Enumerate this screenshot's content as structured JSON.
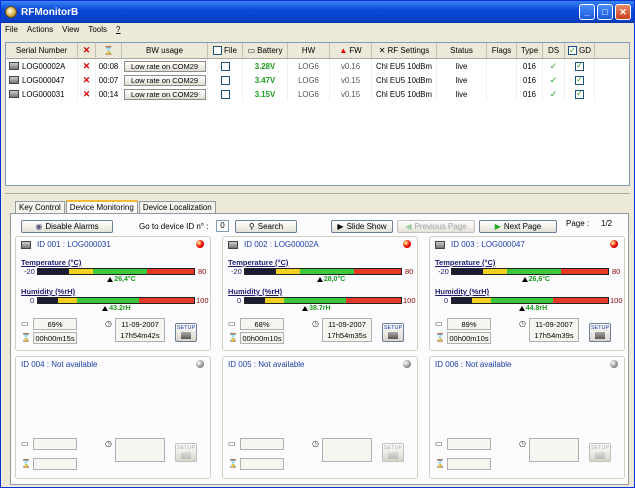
{
  "window": {
    "title": "RFMonitorB"
  },
  "menu": [
    "File",
    "Actions",
    "View",
    "Tools",
    "?"
  ],
  "grid": {
    "headers": {
      "serial": "Serial Number",
      "bw": "BW usage",
      "file": "File",
      "battery": "Battery",
      "hw": "HW",
      "fw": "FW",
      "rf": "RF Settings",
      "status": "Status",
      "flags": "Flags",
      "type": "Type",
      "ds": "DS",
      "gd": "GD"
    },
    "rows": [
      {
        "serial": "LOG00002A",
        "time": "00:08",
        "bw": "Low rate on COM29",
        "battery": "3.28V",
        "hw": "LOG6",
        "fw": "v0.16",
        "rf": "Chl EU5 10dBm",
        "status": "live",
        "type": "016"
      },
      {
        "serial": "LOG000047",
        "time": "00:07",
        "bw": "Low rate on COM29",
        "battery": "3.47V",
        "hw": "LOG6",
        "fw": "v0.15",
        "rf": "Chl EU5 10dBm",
        "status": "live",
        "type": "016"
      },
      {
        "serial": "LOG000031",
        "time": "00:14",
        "bw": "Low rate on COM29",
        "battery": "3.15V",
        "hw": "LOG6",
        "fw": "v0.15",
        "rf": "Chl EU5 10dBm",
        "status": "live",
        "type": "016"
      }
    ]
  },
  "tabs": [
    "Key Control",
    "Device Monitoring",
    "Device Localization"
  ],
  "toolbar": {
    "disable_alarms": "Disable Alarms",
    "goto_label": "Go to device ID n° :",
    "goto_value": "0",
    "search": "Search",
    "slideshow": "Slide Show",
    "prev": "Previous Page",
    "next": "Next Page",
    "page_label": "Page :",
    "page_value": "1/2"
  },
  "cards": [
    {
      "title": "ID 001 : LOG000031",
      "temp_label": "Temperature (°C)",
      "temp_min": "-20",
      "temp_max": "80",
      "temp_val": "26,4°C",
      "temp_frac": 0.464,
      "hum_label": "Humidity (%rH)",
      "hum_min": "0",
      "hum_max": "100",
      "hum_val": "43.2rH",
      "hum_frac": 0.432,
      "battery": "69%",
      "date": "11-09-2007",
      "time": "17h54m42s",
      "uptime": "00h00m15s",
      "setup": "SETUP"
    },
    {
      "title": "ID 002 : LOG00002A",
      "temp_label": "Temperature (°C)",
      "temp_min": "-20",
      "temp_max": "80",
      "temp_val": "28,0°C",
      "temp_frac": 0.48,
      "hum_label": "Humidity (%rH)",
      "hum_min": "0",
      "hum_max": "100",
      "hum_val": "38.7rH",
      "hum_frac": 0.387,
      "battery": "68%",
      "date": "11-09-2007",
      "time": "17h54m35s",
      "uptime": "00h00m10s",
      "setup": "SETUP"
    },
    {
      "title": "ID 003 : LOG000047",
      "temp_label": "Temperature (°C)",
      "temp_min": "-20",
      "temp_max": "80",
      "temp_val": "26,6°C",
      "temp_frac": 0.466,
      "hum_label": "Humidity (%rH)",
      "hum_min": "0",
      "hum_max": "100",
      "hum_val": "44.8rH",
      "hum_frac": 0.448,
      "battery": "89%",
      "date": "11-09-2007",
      "time": "17h54m39s",
      "uptime": "00h00m10s",
      "setup": "SETUP"
    }
  ],
  "empty_cards": [
    {
      "title": "ID 004 : Not available",
      "setup": "SETUP"
    },
    {
      "title": "ID 005 : Not available",
      "setup": "SETUP"
    },
    {
      "title": "ID 006 : Not available",
      "setup": "SETUP"
    }
  ]
}
